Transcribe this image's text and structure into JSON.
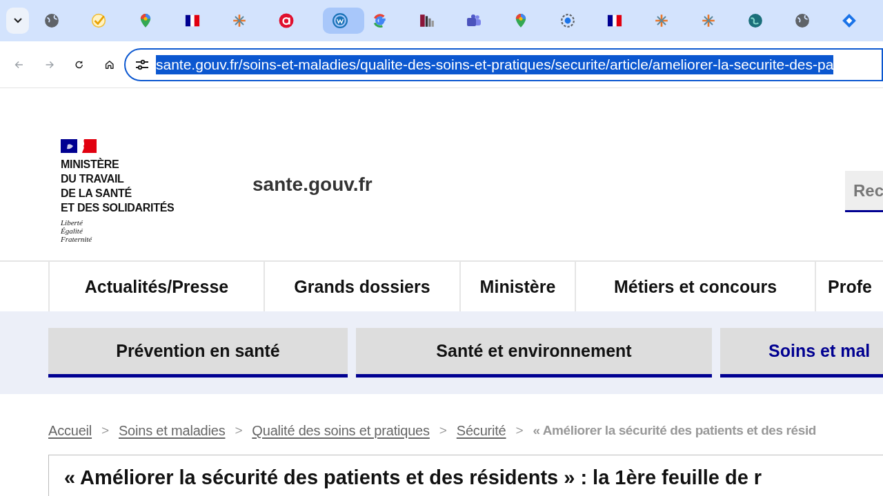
{
  "browser": {
    "tabs": [
      {
        "kind": "globe",
        "selected": false
      },
      {
        "kind": "check",
        "selected": false
      },
      {
        "kind": "pin",
        "selected": false
      },
      {
        "kind": "flag",
        "selected": false
      },
      {
        "kind": "cross",
        "selected": false
      },
      {
        "kind": "a-logo",
        "selected": false
      },
      {
        "kind": "wp",
        "selected": true
      },
      {
        "kind": "g-logo",
        "selected": false
      },
      {
        "kind": "chart",
        "selected": false
      },
      {
        "kind": "teams",
        "selected": false
      },
      {
        "kind": "pin",
        "selected": false
      },
      {
        "kind": "ring",
        "selected": false
      },
      {
        "kind": "flag",
        "selected": false
      },
      {
        "kind": "cross",
        "selected": false
      },
      {
        "kind": "cross",
        "selected": false
      },
      {
        "kind": "earth",
        "selected": false
      },
      {
        "kind": "globe",
        "selected": false
      },
      {
        "kind": "diamond",
        "selected": false
      }
    ],
    "url": {
      "value": "sante.gouv.fr/soins-et-maladies/qualite-des-soins-et-pratiques/securite/article/ameliorer-la-securite-des-pa",
      "selected": true
    }
  },
  "header": {
    "logo_lines": [
      "MINISTÈRE",
      "DU TRAVAIL",
      "DE LA SANTÉ",
      "ET DES SOLIDARITÉS"
    ],
    "motto": [
      "Liberté",
      "Égalité",
      "Fraternité"
    ],
    "site_name": "sante.gouv.fr",
    "top_button": "Rec"
  },
  "nav": [
    {
      "label": "Actualités/Presse"
    },
    {
      "label": "Grands dossiers"
    },
    {
      "label": "Ministère"
    },
    {
      "label": "Métiers et concours"
    },
    {
      "label": "Profe"
    }
  ],
  "subnav": [
    {
      "label": "Prévention en santé",
      "selected": false
    },
    {
      "label": "Santé et environnement",
      "selected": false
    },
    {
      "label": "Soins et mal",
      "selected": true
    }
  ],
  "breadcrumb": [
    {
      "kind": "link",
      "text": "Accueil"
    },
    {
      "kind": "separator",
      "text": ">"
    },
    {
      "kind": "link",
      "text": "Soins et maladies"
    },
    {
      "kind": "separator",
      "text": ">"
    },
    {
      "kind": "link",
      "text": "Qualité des soins et pratiques"
    },
    {
      "kind": "separator",
      "text": ">"
    },
    {
      "kind": "link",
      "text": "Sécurité"
    },
    {
      "kind": "separator",
      "text": ">"
    },
    {
      "kind": "current",
      "text": "« Améliorer la sécurité des patients et des résid"
    }
  ],
  "article": {
    "title": "« Améliorer la sécurité des patients et des résidents » : la 1ère feuille de r"
  }
}
